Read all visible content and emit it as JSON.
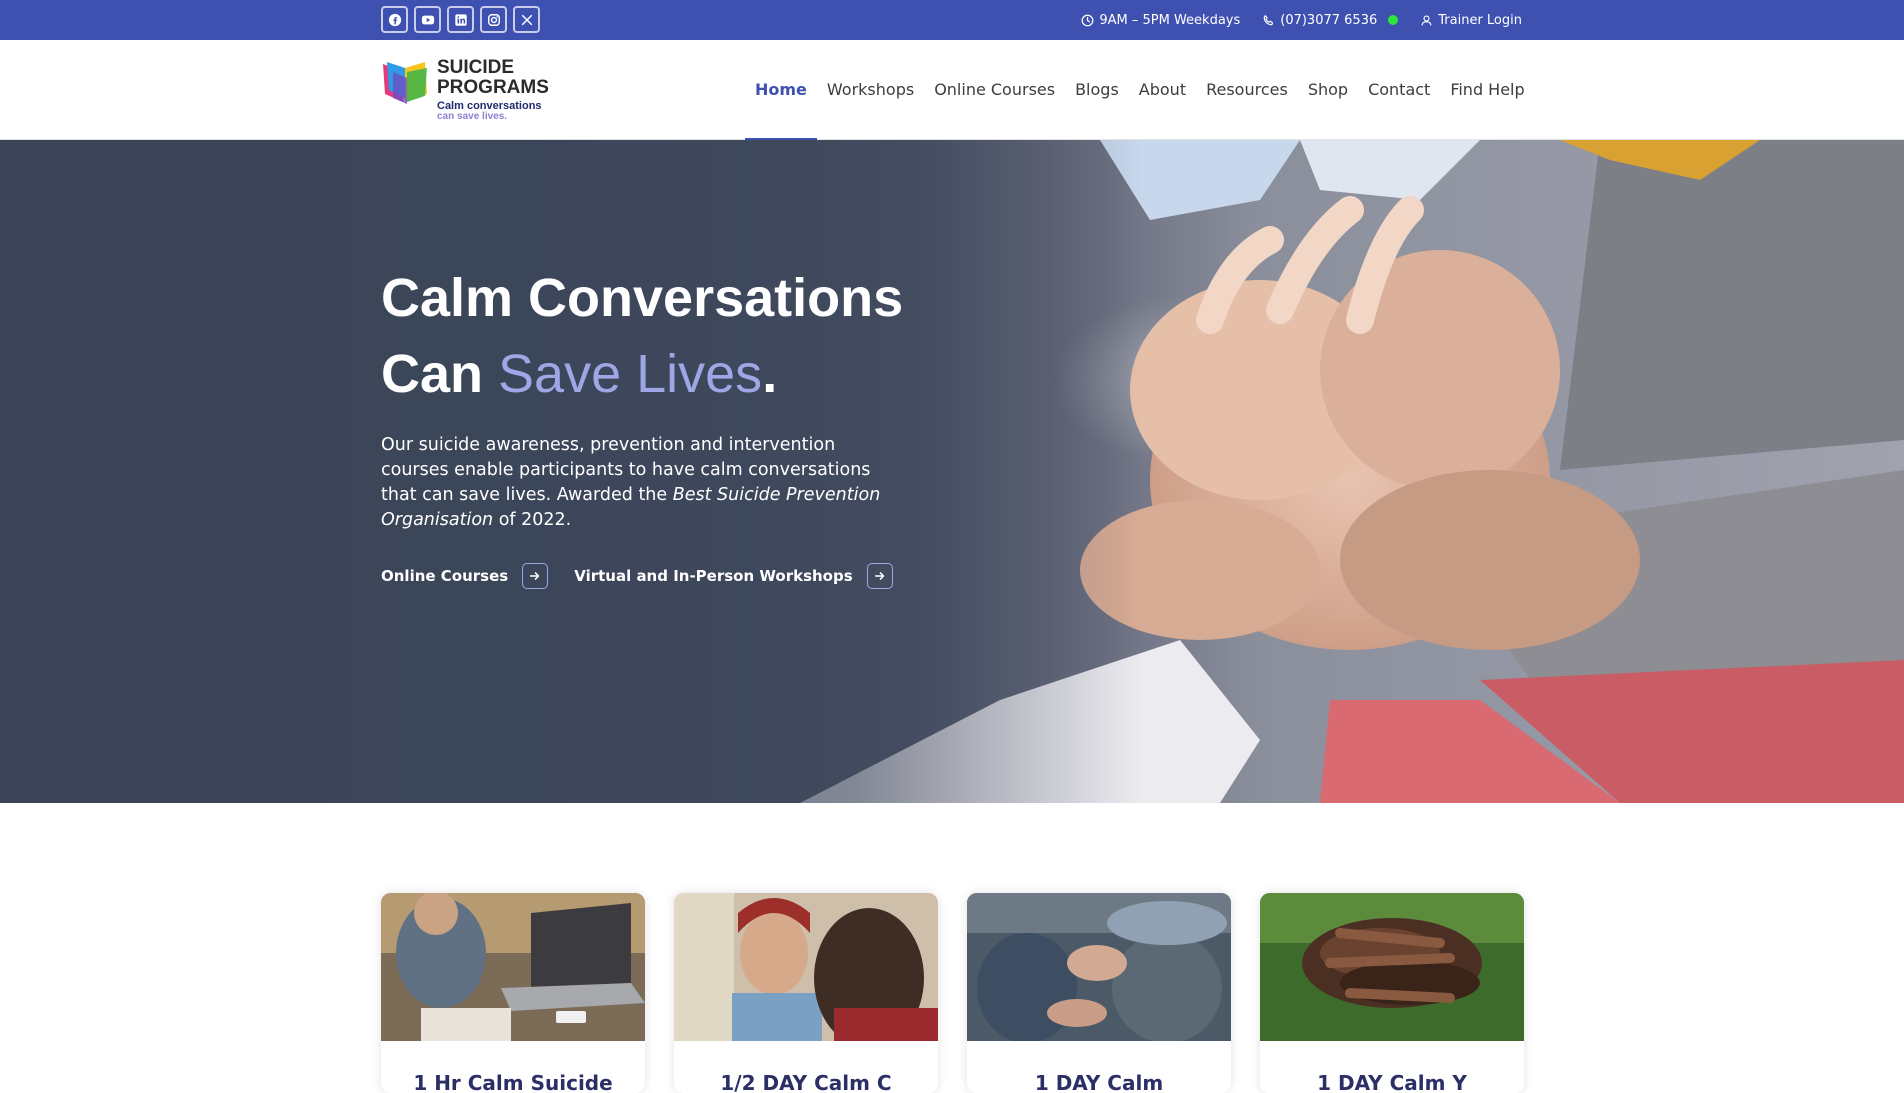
{
  "topbar": {
    "socials": [
      {
        "icon": "facebook-icon"
      },
      {
        "icon": "youtube-icon"
      },
      {
        "icon": "linkedin-icon"
      },
      {
        "icon": "instagram-icon"
      },
      {
        "icon": "x-twitter-icon"
      }
    ],
    "hours": "9AM – 5PM Weekdays",
    "phone": "(07)3077 6536",
    "login": "Trainer Login",
    "bar_color": "#3f51b0"
  },
  "logo": {
    "line1": "SUICIDE",
    "line2": "PROGRAMS",
    "tagline1": "Calm conversations",
    "tagline2": "can save lives."
  },
  "nav": {
    "items": [
      {
        "label": "Home",
        "active": true
      },
      {
        "label": "Workshops"
      },
      {
        "label": "Online Courses"
      },
      {
        "label": "Blogs"
      },
      {
        "label": "About"
      },
      {
        "label": "Resources"
      },
      {
        "label": "Shop"
      },
      {
        "label": "Contact"
      },
      {
        "label": "Find Help"
      }
    ]
  },
  "hero": {
    "title_line1": "Calm Conversations",
    "title_line2_start": "Can ",
    "title_line2_accent": "Save Lives",
    "title_line2_end": ".",
    "desc_part1": "Our suicide awareness, prevention and intervention courses enable participants to have calm conversations that can save lives. Awarded the ",
    "desc_italic": "Best Suicide Prevention Organisation",
    "desc_part2": " of 2022.",
    "link1": "Online Courses",
    "link2": "Virtual and In-Person Workshops",
    "accent_color": "#9ea6e6"
  },
  "cards": [
    {
      "title": "1 Hr Calm Suicide"
    },
    {
      "title": "1/2 DAY Calm C"
    },
    {
      "title": "1 DAY Calm"
    },
    {
      "title": "1 DAY Calm Y"
    }
  ]
}
